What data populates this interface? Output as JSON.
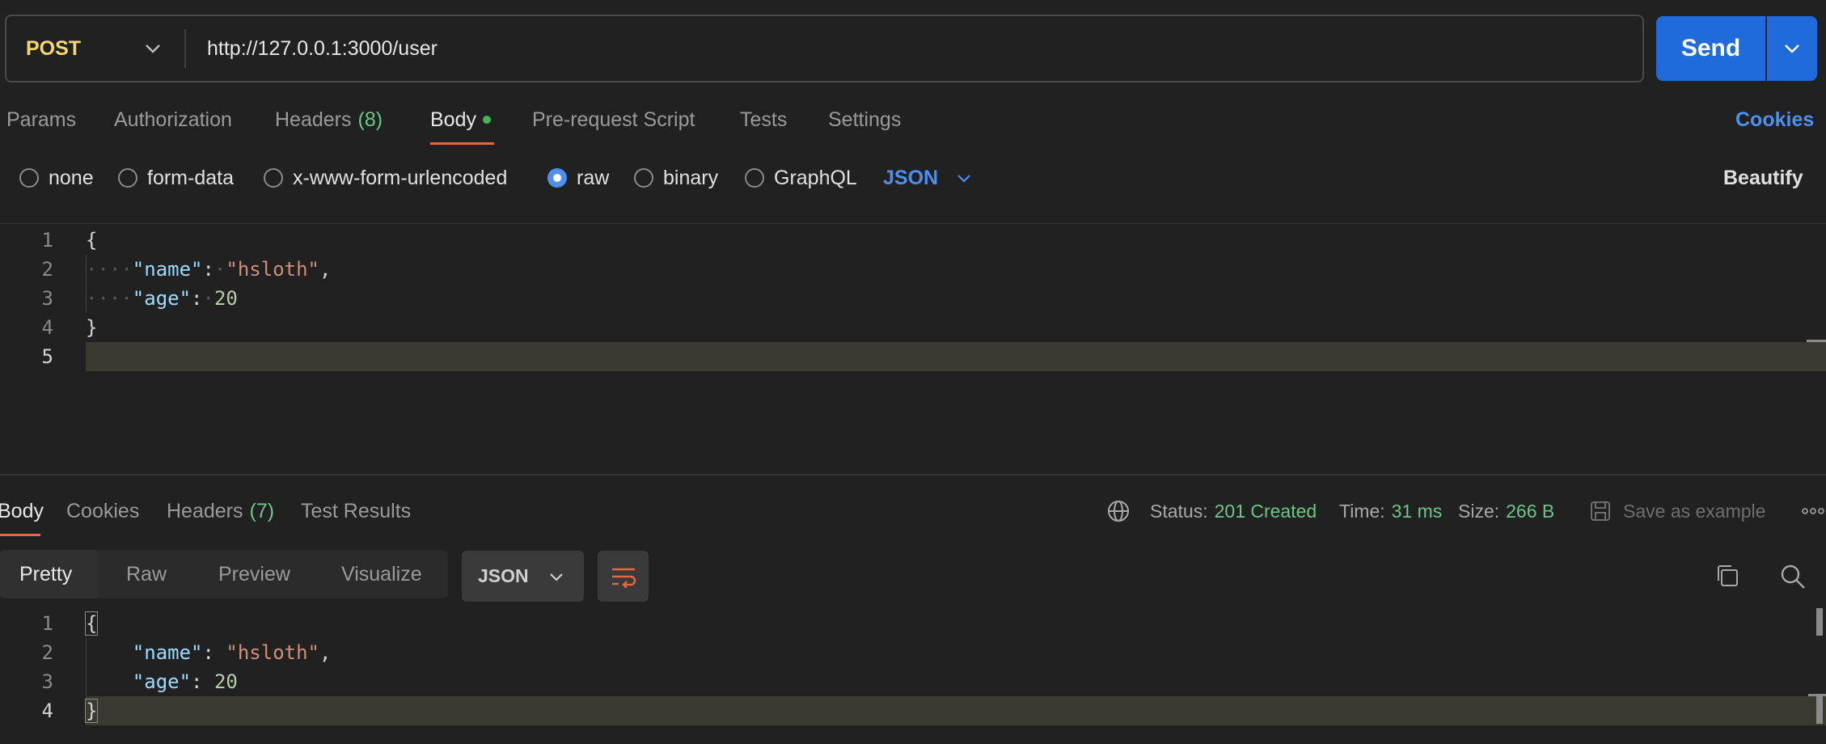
{
  "request": {
    "method": "POST",
    "url": "http://127.0.0.1:3000/user",
    "send_label": "Send"
  },
  "request_tabs": {
    "params": "Params",
    "authorization": "Authorization",
    "headers": "Headers",
    "headers_count": "(8)",
    "body": "Body",
    "pre_request": "Pre-request Script",
    "tests": "Tests",
    "settings": "Settings",
    "cookies": "Cookies"
  },
  "body_types": {
    "none": "none",
    "form_data": "form-data",
    "urlencoded": "x-www-form-urlencoded",
    "raw": "raw",
    "binary": "binary",
    "graphql": "GraphQL",
    "format": "JSON",
    "beautify": "Beautify",
    "selected": "raw"
  },
  "request_body": {
    "line_numbers": [
      "1",
      "2",
      "3",
      "4",
      "5"
    ],
    "open_brace": "{",
    "close_brace": "}",
    "indent": "····",
    "name_key": "\"name\"",
    "name_value": "\"hsloth\"",
    "age_key": "\"age\"",
    "age_value": "20",
    "colon": ":",
    "comma": ","
  },
  "response_tabs": {
    "body": "Body",
    "cookies": "Cookies",
    "headers": "Headers",
    "headers_count": "(7)",
    "test_results": "Test Results"
  },
  "response_meta": {
    "status_label": "Status:",
    "status_value": "201 Created",
    "time_label": "Time:",
    "time_value": "31 ms",
    "size_label": "Size:",
    "size_value": "266 B",
    "save_example": "Save as example"
  },
  "response_view": {
    "pretty": "Pretty",
    "raw": "Raw",
    "preview": "Preview",
    "visualize": "Visualize",
    "format": "JSON"
  },
  "response_body": {
    "line_numbers": [
      "1",
      "2",
      "3",
      "4"
    ],
    "open_brace": "{",
    "close_brace": "}",
    "name_key": "\"name\"",
    "name_value": "\"hsloth\"",
    "age_key": "\"age\"",
    "age_value": "20",
    "colon": ":",
    "comma": ","
  },
  "colors": {
    "background": "#212121",
    "accent_blue": "#1f6bdc",
    "method_yellow": "#f5d76e",
    "tab_underline": "#e8663d",
    "success_green": "#6cc785"
  }
}
